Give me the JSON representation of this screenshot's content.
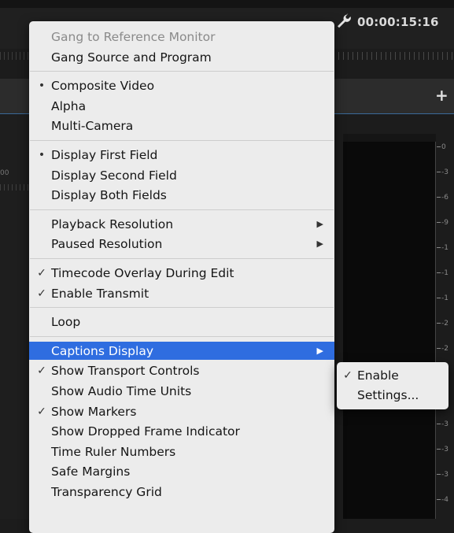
{
  "header": {
    "timecode": "00:00:15:16",
    "wrench_icon": "wrench-icon",
    "add_icon": "plus-icon",
    "add_label": "+"
  },
  "left_panel": {
    "ruler_number": "00"
  },
  "meter": {
    "ticks": [
      "0",
      "-3",
      "-6",
      "-9",
      "-1",
      "-1",
      "-1",
      "-2",
      "-2",
      "-2",
      "-3",
      "-3",
      "-3",
      "-3",
      "-4"
    ]
  },
  "menu": {
    "groups": [
      [
        {
          "label": "Gang to Reference Monitor",
          "mark": "",
          "disabled": true
        },
        {
          "label": "Gang Source and Program",
          "mark": ""
        }
      ],
      [
        {
          "label": "Composite Video",
          "mark": "•"
        },
        {
          "label": "Alpha",
          "mark": ""
        },
        {
          "label": "Multi-Camera",
          "mark": ""
        }
      ],
      [
        {
          "label": "Display First Field",
          "mark": "•"
        },
        {
          "label": "Display Second Field",
          "mark": ""
        },
        {
          "label": "Display Both Fields",
          "mark": ""
        }
      ],
      [
        {
          "label": "Playback Resolution",
          "mark": "",
          "submenu": true
        },
        {
          "label": "Paused Resolution",
          "mark": "",
          "submenu": true
        }
      ],
      [
        {
          "label": "Timecode Overlay During Edit",
          "mark": "✓"
        },
        {
          "label": "Enable Transmit",
          "mark": "✓"
        }
      ],
      [
        {
          "label": "Loop",
          "mark": ""
        }
      ],
      [
        {
          "label": "Captions Display",
          "mark": "",
          "submenu": true,
          "highlighted": true
        },
        {
          "label": "Show Transport Controls",
          "mark": "✓"
        },
        {
          "label": "Show Audio Time Units",
          "mark": ""
        },
        {
          "label": "Show Markers",
          "mark": "✓"
        },
        {
          "label": "Show Dropped Frame Indicator",
          "mark": ""
        },
        {
          "label": "Time Ruler Numbers",
          "mark": ""
        },
        {
          "label": "Safe Margins",
          "mark": ""
        },
        {
          "label": "Transparency Grid",
          "mark": ""
        }
      ]
    ],
    "bullet_icon": "bullet-icon",
    "check_icon": "checkmark-icon",
    "arrow_icon": "submenu-arrow-icon",
    "arrow_glyph": "▶"
  },
  "submenu": {
    "items": [
      {
        "label": "Enable",
        "mark": "✓"
      },
      {
        "label": "Settings...",
        "mark": ""
      }
    ]
  },
  "colors": {
    "highlight": "#2f6de0",
    "menu_bg": "#ececec",
    "app_bg": "#1c1c1c"
  }
}
